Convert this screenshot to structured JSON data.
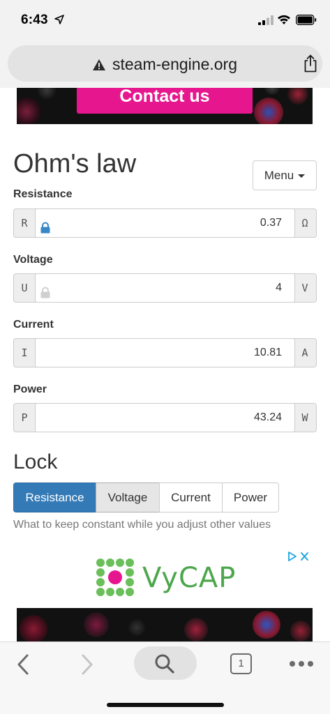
{
  "status_bar": {
    "time": "6:43"
  },
  "browser": {
    "url": "steam-engine.org",
    "tab_count": "1"
  },
  "ads": {
    "top_banner_button": "Contact us",
    "bottom_brand": "VyCAP"
  },
  "page": {
    "title": "Ohm's law",
    "menu_label": "Menu"
  },
  "fields": [
    {
      "label": "Resistance",
      "symbol": "R",
      "value": "0.37",
      "unit": "Ω",
      "locked": true
    },
    {
      "label": "Voltage",
      "symbol": "U",
      "value": "4",
      "unit": "V",
      "locked": false
    },
    {
      "label": "Current",
      "symbol": "I",
      "value": "10.81",
      "unit": "A"
    },
    {
      "label": "Power",
      "symbol": "P",
      "value": "43.24",
      "unit": "W"
    }
  ],
  "lock": {
    "title": "Lock",
    "options": [
      "Resistance",
      "Voltage",
      "Current",
      "Power"
    ],
    "selected": "Resistance",
    "help_text": "What to keep constant while you adjust other values"
  },
  "colors": {
    "accent_blue": "#337ab7",
    "ad_pink": "#e6168e",
    "vycap_green": "#4ca64c"
  }
}
